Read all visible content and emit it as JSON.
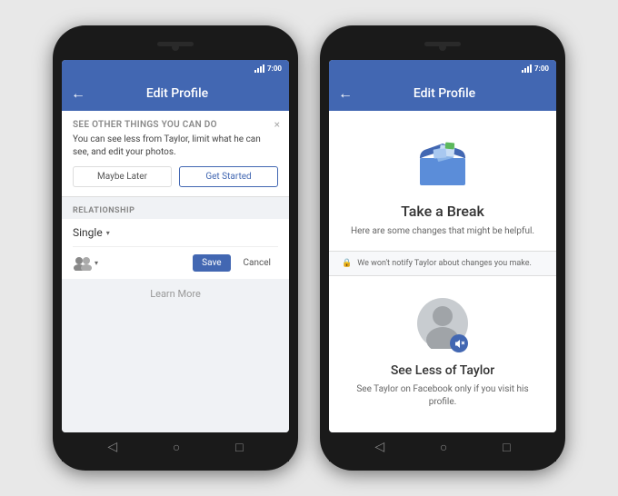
{
  "colors": {
    "facebook_blue": "#4267b2",
    "background": "#e8e8e8",
    "phone_body": "#1a1a1a",
    "text_dark": "#333333",
    "text_medium": "#555555",
    "text_light": "#888888"
  },
  "phone_left": {
    "status_time": "7:00",
    "nav_title": "Edit Profile",
    "back_arrow": "←",
    "notification": {
      "title": "See Other Things You Can Do",
      "text": "You can see less from Taylor, limit what he can see, and edit your photos.",
      "close_label": "×",
      "btn_maybe": "Maybe Later",
      "btn_started": "Get Started"
    },
    "section_label": "RELATIONSHIP",
    "relationship_value": "Single",
    "save_label": "Save",
    "cancel_label": "Cancel",
    "learn_more": "Learn More"
  },
  "phone_right": {
    "status_time": "7:00",
    "nav_title": "Edit Profile",
    "back_arrow": "←",
    "take_break": {
      "title": "Take a Break",
      "subtitle": "Here are some changes that might be helpful."
    },
    "privacy_notice": "We won't notify Taylor about changes you make.",
    "see_less": {
      "title": "See Less of Taylor",
      "text": "See Taylor on Facebook only if you visit his profile."
    }
  },
  "nav_icons": {
    "back": "◁",
    "home": "○",
    "square": "□"
  }
}
